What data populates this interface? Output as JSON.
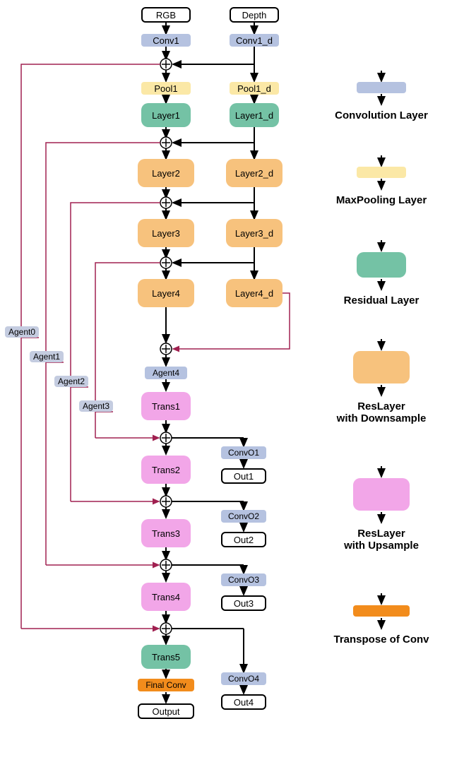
{
  "inputs": {
    "rgb": "RGB",
    "depth": "Depth"
  },
  "conv": {
    "conv1": "Conv1",
    "conv1_d": "Conv1_d"
  },
  "pool": {
    "pool1": "Pool1",
    "pool1_d": "Pool1_d"
  },
  "layers": {
    "layer1": "Layer1",
    "layer1_d": "Layer1_d",
    "layer2": "Layer2",
    "layer2_d": "Layer2_d",
    "layer3": "Layer3",
    "layer3_d": "Layer3_d",
    "layer4": "Layer4",
    "layer4_d": "Layer4_d"
  },
  "agents": {
    "agent0": "Agent0",
    "agent1": "Agent1",
    "agent2": "Agent2",
    "agent3": "Agent3",
    "agent4": "Agent4"
  },
  "trans": {
    "trans1": "Trans1",
    "trans2": "Trans2",
    "trans3": "Trans3",
    "trans4": "Trans4",
    "trans5": "Trans5"
  },
  "convO": {
    "o1": "ConvO1",
    "o2": "ConvO2",
    "o3": "ConvO3",
    "o4": "ConvO4"
  },
  "outputs": {
    "out1": "Out1",
    "out2": "Out2",
    "out3": "Out3",
    "out4": "Out4",
    "output": "Output"
  },
  "final": "Final Conv",
  "legend": {
    "conv": "Convolution Layer",
    "maxpool": "MaxPooling Layer",
    "residual": "Residual Layer",
    "resdown": "ResLayer\nwith Downsample",
    "resup": "ResLayer\nwith Upsample",
    "transconv": "Transpose of Conv"
  }
}
